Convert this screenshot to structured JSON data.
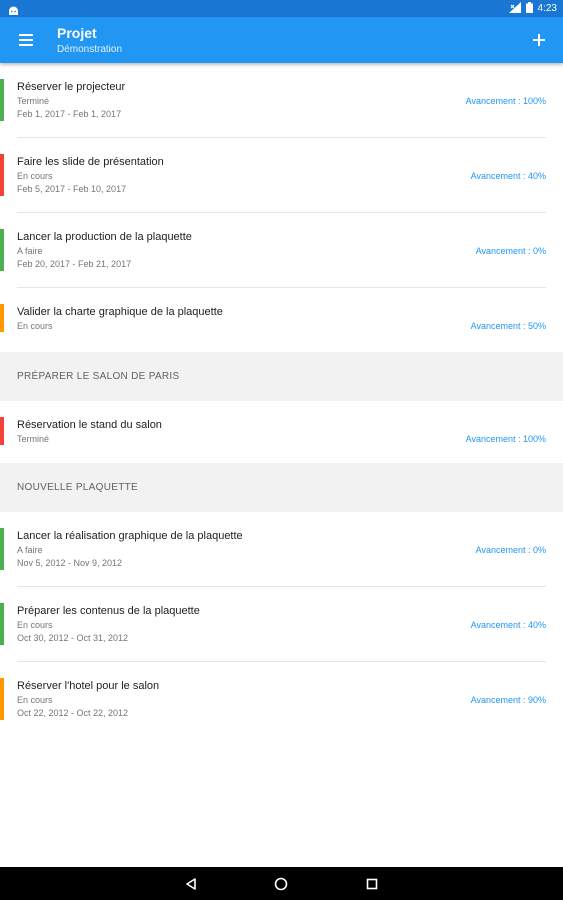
{
  "status_bar": {
    "time": "4:23"
  },
  "app_bar": {
    "title": "Projet",
    "subtitle": "Démonstration"
  },
  "colors": {
    "done": "#4caf50",
    "in_progress": "#ff9800",
    "todo": "#f44336",
    "primary": "#2196f3"
  },
  "groups": [
    {
      "header": "",
      "tasks": [
        {
          "name": "Réserver le projecteur",
          "status": "Terminé",
          "dates": "Feb 1, 2017 - Feb 1, 2017",
          "progress": "Avancement : 100%",
          "color": "#4caf50"
        },
        {
          "name": "Faire les slide de présentation",
          "status": "En cours",
          "dates": "Feb 5, 2017 - Feb 10, 2017",
          "progress": "Avancement : 40%",
          "color": "#f44336"
        },
        {
          "name": "Lancer la production de la plaquette",
          "status": "A faire",
          "dates": "Feb 20, 2017 - Feb 21, 2017",
          "progress": "Avancement : 0%",
          "color": "#4caf50"
        },
        {
          "name": "Valider la charte graphique de la plaquette",
          "status": "En cours",
          "dates": "",
          "progress": "Avancement : 50%",
          "color": "#ff9800"
        }
      ]
    },
    {
      "header": "PRÉPARER LE SALON DE PARIS",
      "tasks": [
        {
          "name": "Réservation le stand du salon",
          "status": "Terminé",
          "dates": "",
          "progress": "Avancement : 100%",
          "color": "#f44336"
        }
      ]
    },
    {
      "header": "NOUVELLE PLAQUETTE",
      "tasks": [
        {
          "name": "Lancer la réalisation graphique de la plaquette",
          "status": "A faire",
          "dates": "Nov 5, 2012 - Nov 9, 2012",
          "progress": "Avancement : 0%",
          "color": "#4caf50"
        },
        {
          "name": "Préparer les contenus de la plaquette",
          "status": "En cours",
          "dates": "Oct 30, 2012 - Oct 31, 2012",
          "progress": "Avancement : 40%",
          "color": "#4caf50"
        },
        {
          "name": "Réserver l'hotel pour le salon",
          "status": "En cours",
          "dates": "Oct 22, 2012 - Oct 22, 2012",
          "progress": "Avancement : 90%",
          "color": "#ff9800"
        }
      ]
    }
  ]
}
